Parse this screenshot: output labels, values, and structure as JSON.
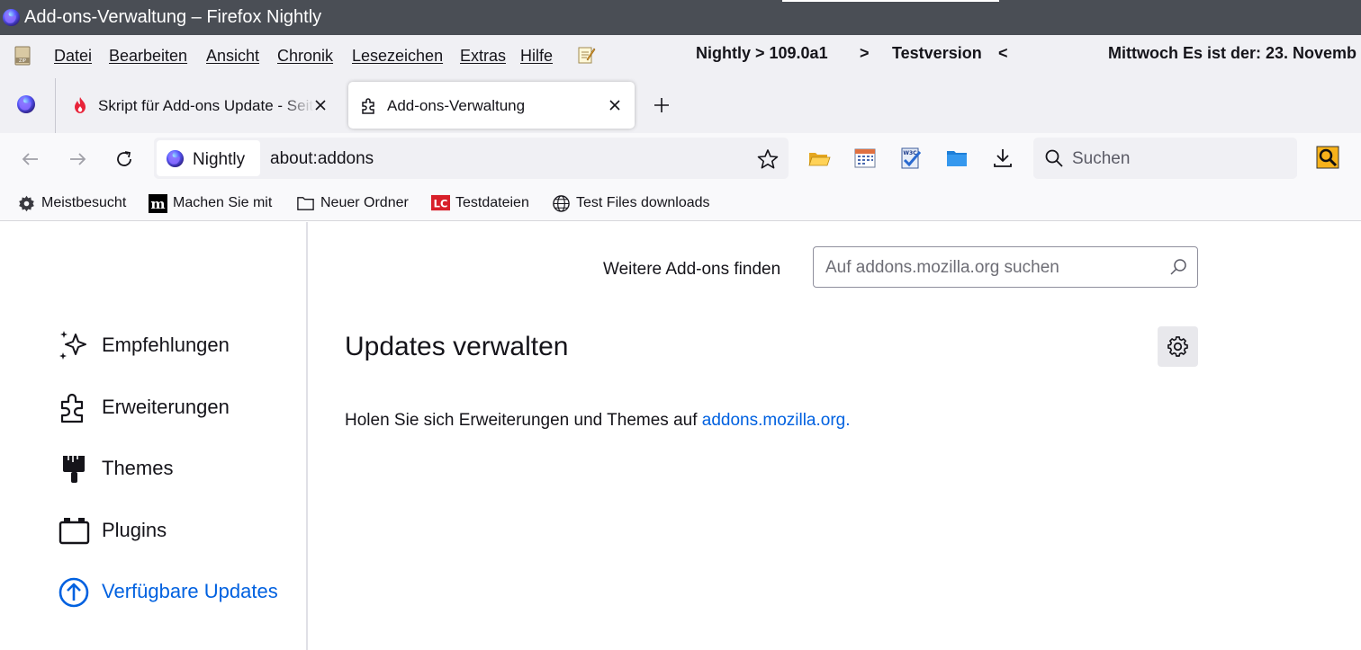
{
  "window": {
    "title": "Add-ons-Verwaltung – Firefox Nightly"
  },
  "menubar": {
    "items": [
      "Datei",
      "Bearbeiten",
      "Ansicht",
      "Chronik",
      "Lesezeichen",
      "Extras",
      "Hilfe"
    ],
    "version_info": "Nightly > 109.0a1",
    "arrow_right": ">",
    "test_label": "Testversion",
    "arrow_left": "<",
    "date_info": "Mittwoch Es ist der: 23. Novemb"
  },
  "tabs": [
    {
      "label": "Skript für Add-ons Update - Seite",
      "active": false
    },
    {
      "label": "Add-ons-Verwaltung",
      "active": true
    }
  ],
  "navbar": {
    "identity_label": "Nightly",
    "url": "about:addons",
    "search_placeholder": "Suchen"
  },
  "bookmarks": [
    {
      "label": "Meistbesucht",
      "icon": "gear-icon"
    },
    {
      "label": "Machen Sie mit",
      "icon": "mozilla-m-icon"
    },
    {
      "label": "Neuer Ordner",
      "icon": "folder-icon"
    },
    {
      "label": "Testdateien",
      "icon": "lc-icon"
    },
    {
      "label": "Test Files downloads",
      "icon": "globe-icon"
    }
  ],
  "sidebar": {
    "categories": [
      {
        "label": "Empfehlungen",
        "icon": "sparkle-icon"
      },
      {
        "label": "Erweiterungen",
        "icon": "puzzle-icon"
      },
      {
        "label": "Themes",
        "icon": "brush-icon"
      },
      {
        "label": "Plugins",
        "icon": "plugin-icon"
      },
      {
        "label": "Verfügbare Updates",
        "icon": "arrow-up-circle-icon",
        "selected": true
      }
    ]
  },
  "main": {
    "find_label": "Weitere Add-ons finden",
    "search_placeholder": "Auf addons.mozilla.org suchen",
    "title": "Updates verwalten",
    "info_prefix": "Holen Sie sich Erweiterungen und Themes auf ",
    "info_link": "addons.mozilla.org",
    "info_suffix": "."
  },
  "colors": {
    "titlebar": "#4a4e55",
    "accent": "#0061e0",
    "toolbar": "#f0f0f4"
  }
}
